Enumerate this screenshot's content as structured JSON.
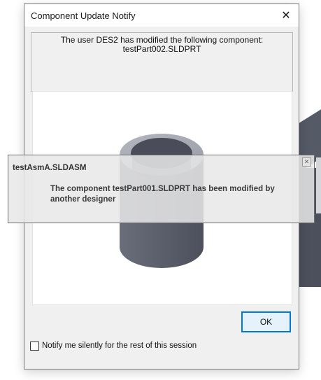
{
  "dialog": {
    "title": "Component Update Notify",
    "close_glyph": "✕",
    "message": {
      "line1": "The user DES2 has modified the following component:",
      "line2": "testPart002.SLDPRT"
    },
    "ok_label": "OK",
    "checkbox": {
      "label": "Notify me silently for the rest of this session",
      "checked": false
    }
  },
  "popup": {
    "title": "testAsmA.SLDASM",
    "message": "The component testPart001.SLDPRT has been modified by another designer",
    "close_glyph": "✕"
  },
  "colors": {
    "accent": "#0078d7",
    "part_body": "#5b5e6b",
    "part_top": "#a7aab3",
    "part_hole": "#4a4d59"
  }
}
